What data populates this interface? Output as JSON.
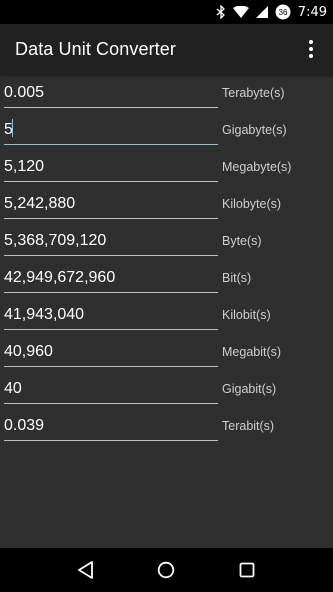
{
  "status_bar": {
    "time": "7:49",
    "icons": [
      "bluetooth-icon",
      "wifi-icon",
      "signal-icon",
      "battery-icon"
    ],
    "battery_level": "36"
  },
  "app_bar": {
    "title": "Data Unit Converter",
    "menu_icon": "more-vert-icon"
  },
  "rows": [
    {
      "value": "0.005",
      "unit": "Terabyte(s)"
    },
    {
      "value": "5",
      "unit": "Gigabyte(s)",
      "focused": true
    },
    {
      "value": "5,120",
      "unit": "Megabyte(s)"
    },
    {
      "value": "5,242,880",
      "unit": "Kilobyte(s)"
    },
    {
      "value": "5,368,709,120",
      "unit": "Byte(s)"
    },
    {
      "value": "42,949,672,960",
      "unit": "Bit(s)"
    },
    {
      "value": "41,943,040",
      "unit": "Kilobit(s)"
    },
    {
      "value": "40,960",
      "unit": "Megabit(s)"
    },
    {
      "value": "40",
      "unit": "Gigabit(s)"
    },
    {
      "value": "0.039",
      "unit": "Terabit(s)"
    }
  ],
  "nav_bar": {
    "buttons": [
      "back-icon",
      "home-icon",
      "recents-icon"
    ]
  },
  "colors": {
    "background": "#2f2f2f",
    "app_bar": "#212121",
    "accent": "#80cbc4",
    "underline": "#bdbdbd"
  }
}
